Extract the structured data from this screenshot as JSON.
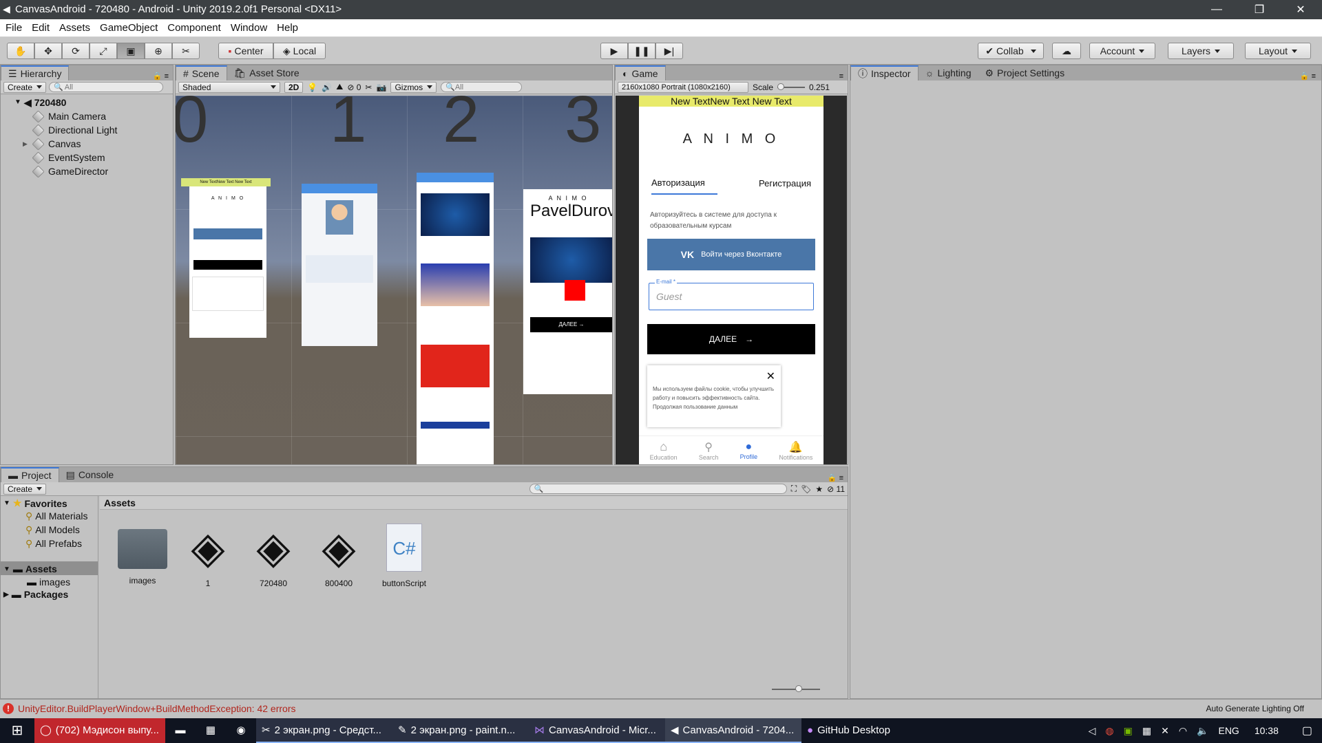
{
  "window": {
    "title": "CanvasAndroid - 720480 - Android - Unity 2019.2.0f1 Personal <DX11>",
    "min": "—",
    "max": "❐",
    "close": "✕"
  },
  "menu": [
    "File",
    "Edit",
    "Assets",
    "GameObject",
    "Component",
    "Window",
    "Help"
  ],
  "toolbar": {
    "pivot_center": "Center",
    "pivot_local": "Local",
    "collab": "Collab",
    "account": "Account",
    "layers": "Layers",
    "layout": "Layout"
  },
  "hierarchy": {
    "tab": "Hierarchy",
    "create": "Create",
    "search_placeholder": "All",
    "scene": "720480",
    "items": [
      "Main Camera",
      "Directional Light",
      "Canvas",
      "EventSystem",
      "GameDirector"
    ]
  },
  "scene": {
    "tabs": [
      "Scene",
      "Asset Store"
    ],
    "shading": "Shaded",
    "mode_2d": "2D",
    "hidden_count": "0",
    "gizmos": "Gizmos",
    "search_placeholder": "All",
    "numbers": [
      "0",
      "1",
      "2",
      "3"
    ],
    "card1_top": "New TextNew Text New Text",
    "card4_brand": "A N I M O",
    "card4_name": "PavelDurov",
    "card4_btn": "ДАЛЕЕ  →"
  },
  "game": {
    "tab": "Game",
    "resolution": "2160x1080 Portrait (1080x2160)",
    "scale_label": "Scale",
    "scale_value": "0.251",
    "top_text": "New TextNew Text  New Text",
    "brand": "A N I M O",
    "tab_auth": "Авторизация",
    "tab_reg": "Регистрация",
    "desc": "Авторизуйтесь в системе для доступа к образовательным курсам",
    "vk_button": "Войти через Вконтакте",
    "email_label": "E-mail *",
    "email_value": "Guest",
    "next_button": "ДАЛЕЕ",
    "cookie_text": "Мы используем файлы cookie, чтобы улучшить работу и повысить эффективность сайта. Продолжая пользование данным",
    "nav": [
      "Education",
      "Search",
      "Profile",
      "Notifications"
    ]
  },
  "inspector": {
    "tabs": [
      "Inspector",
      "Lighting",
      "Project Settings"
    ]
  },
  "project": {
    "tabs": [
      "Project",
      "Console"
    ],
    "create": "Create",
    "hidden_count": "11",
    "favorites": "Favorites",
    "fav_items": [
      "All Materials",
      "All Models",
      "All Prefabs"
    ],
    "assets_root": "Assets",
    "assets_children": [
      "images"
    ],
    "packages": "Packages",
    "breadcrumb": "Assets",
    "files": [
      {
        "name": "images",
        "icon": "folder-icon"
      },
      {
        "name": "1",
        "icon": "unity-scene-icon"
      },
      {
        "name": "720480",
        "icon": "unity-scene-icon"
      },
      {
        "name": "800400",
        "icon": "unity-scene-icon"
      },
      {
        "name": "buttonScript",
        "icon": "csharp-script-icon"
      }
    ]
  },
  "status": {
    "error": "UnityEditor.BuildPlayerWindow+BuildMethodException: 42 errors",
    "right": "Auto Generate Lighting Off"
  },
  "taskbar": {
    "items": [
      "(702) Мэдисон выпу...",
      "2 экран.png - Средст...",
      "2 экран.png - paint.n...",
      "CanvasAndroid - Micr...",
      "CanvasAndroid - 7204...",
      "GitHub Desktop"
    ],
    "lang": "ENG",
    "time": "10:38"
  },
  "colors": {
    "vk": "#4a76a8",
    "accent": "#3c78d8",
    "error": "#d9322a"
  }
}
